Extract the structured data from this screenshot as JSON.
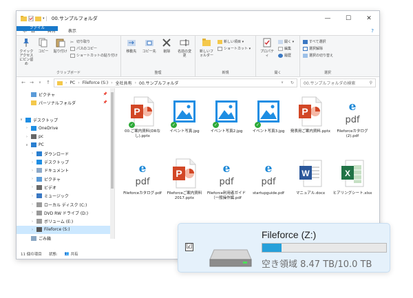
{
  "window": {
    "title": "00.サンプルフォルダ",
    "controls": {
      "minimize": "—",
      "maximize": "☐",
      "close": "✕"
    }
  },
  "ribbon_tabs": [
    "ファイル",
    "ホーム",
    "共有",
    "表示"
  ],
  "help_icon": "?",
  "ribbon": {
    "clipboard": {
      "label": "クリップボード",
      "pin": "クイック アクセスにピン留め",
      "copy": "コピー",
      "paste": "貼り付け",
      "cut": "切り取り",
      "copy_path": "パスのコピー",
      "paste_shortcut": "ショートカットの貼り付け"
    },
    "organize": {
      "label": "整理",
      "move_to": "移動先",
      "copy_to": "コピー先",
      "delete": "削除",
      "rename": "名前の変更"
    },
    "new": {
      "label": "新規",
      "new_folder": "新しいフォルダー",
      "new_item": "新しい項目 ▾",
      "shortcut": "ショートカット ▾"
    },
    "open": {
      "label": "開く",
      "properties": "プロパティ",
      "open": "開く ▾",
      "edit": "編集",
      "history": "履歴"
    },
    "select": {
      "label": "選択",
      "select_all": "すべて選択",
      "select_none": "選択解除",
      "invert": "選択の切り替え"
    }
  },
  "address": {
    "path": [
      "PC",
      "Fileforce (S:)",
      "全社共有",
      "00.サンプルフォルダ"
    ],
    "search_placeholder": "00.サンプルフォルダの検索"
  },
  "nav_items": [
    {
      "label": "ピクチャ",
      "icon": "pictures-icon",
      "arrow": "",
      "indent": 1,
      "pin": "📌"
    },
    {
      "label": "パーソナルフォルダ",
      "icon": "folder-icon",
      "arrow": "",
      "indent": 1,
      "pin": "📌"
    },
    {
      "label": "",
      "icon": "",
      "arrow": "",
      "indent": 0,
      "pin": ""
    },
    {
      "label": "デスクトップ",
      "icon": "desktop-icon",
      "arrow": "∨",
      "indent": 0,
      "pin": ""
    },
    {
      "label": "OneDrive",
      "icon": "cloud-icon",
      "arrow": "›",
      "indent": 1,
      "pin": ""
    },
    {
      "label": "pc",
      "icon": "user-icon",
      "arrow": "›",
      "indent": 1,
      "pin": ""
    },
    {
      "label": "PC",
      "icon": "pc-icon",
      "arrow": "∨",
      "indent": 1,
      "pin": ""
    },
    {
      "label": "ダウンロード",
      "icon": "download-icon",
      "arrow": "›",
      "indent": 2,
      "pin": ""
    },
    {
      "label": "デスクトップ",
      "icon": "desktop-icon",
      "arrow": "›",
      "indent": 2,
      "pin": ""
    },
    {
      "label": "ドキュメント",
      "icon": "documents-icon",
      "arrow": "›",
      "indent": 2,
      "pin": ""
    },
    {
      "label": "ピクチャ",
      "icon": "pictures-icon",
      "arrow": "›",
      "indent": 2,
      "pin": ""
    },
    {
      "label": "ビデオ",
      "icon": "video-icon",
      "arrow": "›",
      "indent": 2,
      "pin": ""
    },
    {
      "label": "ミュージック",
      "icon": "music-icon",
      "arrow": "›",
      "indent": 2,
      "pin": ""
    },
    {
      "label": "ローカル ディスク (C:)",
      "icon": "drive-icon",
      "arrow": "›",
      "indent": 2,
      "pin": ""
    },
    {
      "label": "DVD RW ドライブ (D:)",
      "icon": "dvd-icon",
      "arrow": "›",
      "indent": 2,
      "pin": ""
    },
    {
      "label": "ボリューム (E:)",
      "icon": "drive-icon",
      "arrow": "›",
      "indent": 2,
      "pin": ""
    },
    {
      "label": "Fileforce (S:)",
      "icon": "network-drive-icon",
      "arrow": "›",
      "indent": 2,
      "pin": "",
      "selected": true
    },
    {
      "label": "ごみ箱",
      "icon": "recycle-bin-icon",
      "arrow": "",
      "indent": 1,
      "pin": ""
    }
  ],
  "files": [
    {
      "name": "00.ご案内資料(DRなし).pptx",
      "type": "pptx",
      "synced": true
    },
    {
      "name": "イベント写真.jpg",
      "type": "jpg",
      "synced": true
    },
    {
      "name": "イベント写真2.jpg",
      "type": "jpg",
      "synced": true
    },
    {
      "name": "イベント写真3.jpg",
      "type": "jpg",
      "synced": true
    },
    {
      "name": "発表用ご案内資料.pptx",
      "type": "pptx",
      "synced": false
    },
    {
      "name": "Fileforceカタログ(2).pdf",
      "type": "pdf",
      "synced": false
    },
    {
      "name": "Fileforceカタログ.pdf",
      "type": "pdf",
      "synced": false
    },
    {
      "name": "Fileforceご案内資料2017.pptx",
      "type": "pptx",
      "synced": false
    },
    {
      "name": "Fileforce利用者ガイド（一般操作編.pdf",
      "type": "pdf",
      "synced": false
    },
    {
      "name": "startupguide.pdf",
      "type": "pdf",
      "synced": false
    },
    {
      "name": "マニュアル.docx",
      "type": "docx",
      "synced": false
    },
    {
      "name": "ヒアリングシート.xlsx",
      "type": "xlsx",
      "synced": false
    }
  ],
  "status": {
    "count": "11 個の項目",
    "state_label": "状態:",
    "state_value": "共有"
  },
  "drive_overlay": {
    "name": "Fileforce (Z:)",
    "free_space": "空き領域 8.47 TB/10.0 TB",
    "used_fraction": 0.153,
    "checkbox": "☑"
  },
  "colors": {
    "accent": "#1979ca",
    "pptx": "#d24726",
    "pdf_e": "#1b87d6",
    "word": "#2b579a",
    "excel": "#217346",
    "image": "#1e8ee3",
    "check_green": "#2faa3a",
    "selected_nav": "#cce8ff"
  }
}
